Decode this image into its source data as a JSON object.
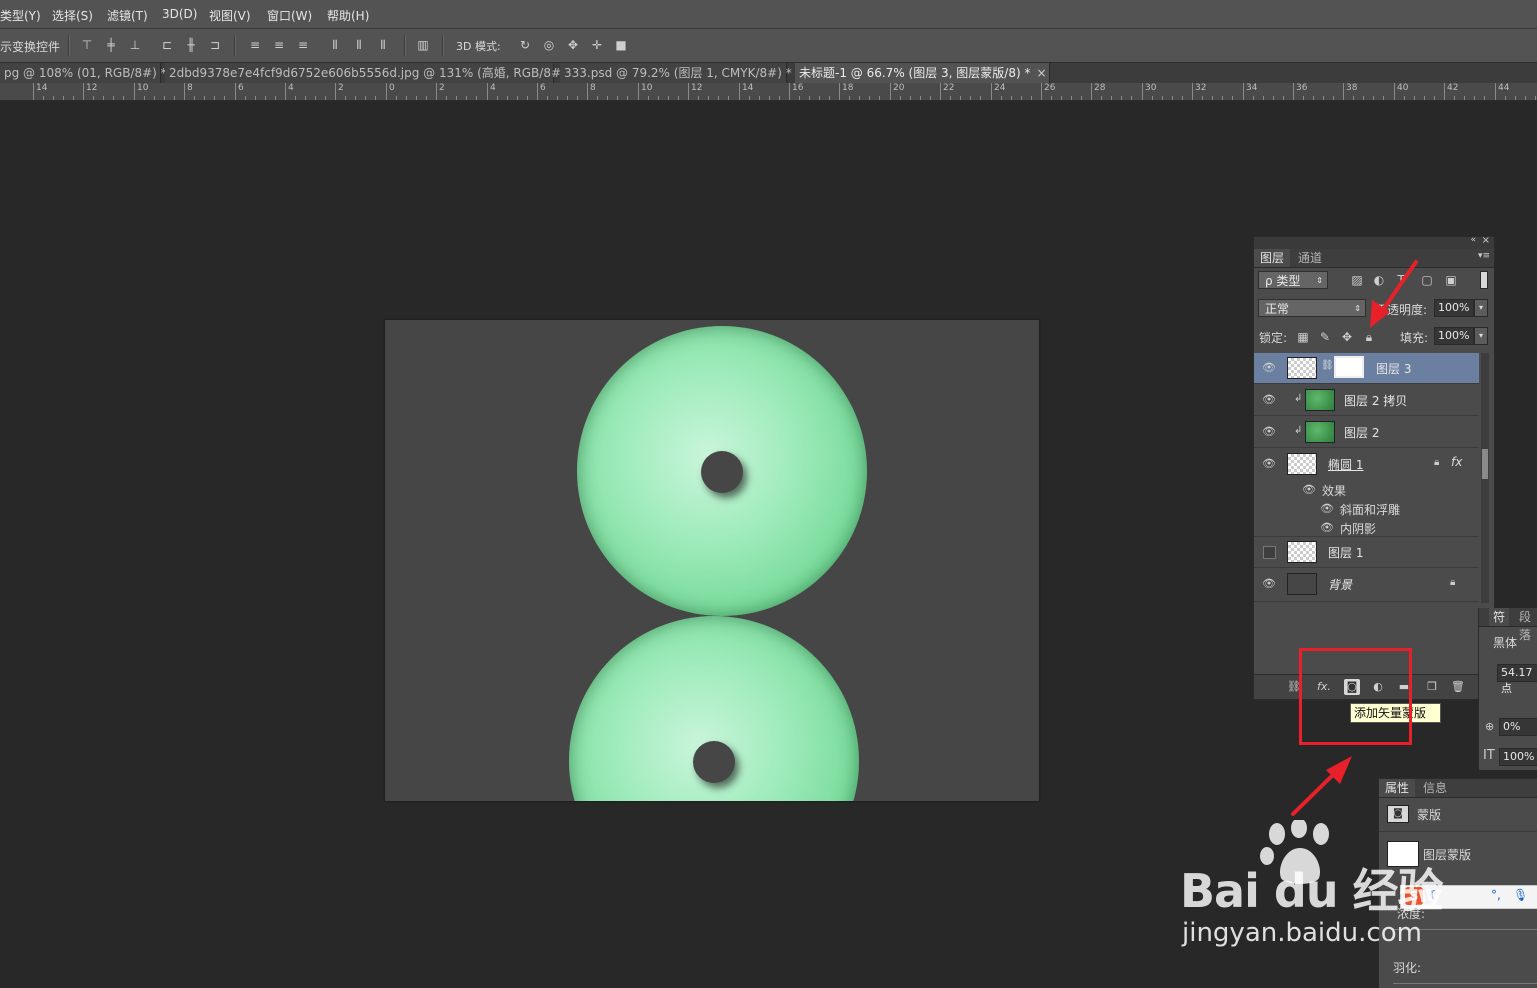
{
  "menu": [
    "类型(Y)",
    "选择(S)",
    "滤镜(T)",
    "3D(D)",
    "视图(V)",
    "窗口(W)",
    "帮助(H)"
  ],
  "options": {
    "transform_controls": "示变换控件",
    "mode_3d": "3D 模式:"
  },
  "tabs": [
    {
      "label": "pg @ 108% (01, RGB/8#) *",
      "close": "×"
    },
    {
      "label": "2dbd9378e7e4fcf9d6752e606b5556d.jpg @ 131% (高婚, RGB/8#) *",
      "close": "×"
    },
    {
      "label": "333.psd @ 79.2% (图层 1, CMYK/8#) *",
      "close": "×"
    },
    {
      "label": "未标题-1 @ 66.7% (图层 3, 图层蒙版/8) *",
      "close": "×"
    }
  ],
  "ruler": [
    "14",
    "12",
    "10",
    "8",
    "6",
    "4",
    "2",
    "0",
    "2",
    "4",
    "6",
    "8",
    "10",
    "12",
    "14",
    "16",
    "18",
    "20",
    "22",
    "24",
    "26",
    "28",
    "30",
    "32",
    "34",
    "36",
    "38",
    "40",
    "42",
    "44"
  ],
  "layers_panel": {
    "tabs": [
      "图层",
      "通道"
    ],
    "filter_kind": "ρ 类型",
    "blend_mode": "正常",
    "opacity_label": "不透明度:",
    "opacity_value": "100%",
    "lock_label": "锁定:",
    "fill_label": "填充:",
    "fill_value": "100%",
    "layers": [
      {
        "name": "图层 3",
        "selected": true
      },
      {
        "name": "图层 2 拷贝"
      },
      {
        "name": "图层 2"
      },
      {
        "name": "椭圆 1",
        "fx": "fx"
      },
      {
        "name": "图层 1"
      },
      {
        "name": "背景"
      }
    ],
    "effects": {
      "title": "效果",
      "items": [
        "斜面和浮雕",
        "内阴影"
      ]
    },
    "bottom_fx": "fx.",
    "tooltip": "添加矢量蒙版"
  },
  "char_panel": {
    "tabs": [
      "符",
      "段落"
    ],
    "font": "黑体",
    "size": "54.17 点",
    "tracking": "0%",
    "scale": "100%"
  },
  "properties_panel": {
    "tabs": [
      "属性",
      "信息"
    ],
    "section": "蒙版",
    "mask_type": "图层蒙版",
    "density_label": "浓度:",
    "feather_label": "羽化:"
  },
  "watermark": {
    "logo": "Bai du 经验",
    "url": "jingyan.baidu.com"
  },
  "colors": {
    "annotation_red": "#e8202a",
    "selected_layer": "#6b7fa0",
    "jade_green": "#7fdea0"
  }
}
